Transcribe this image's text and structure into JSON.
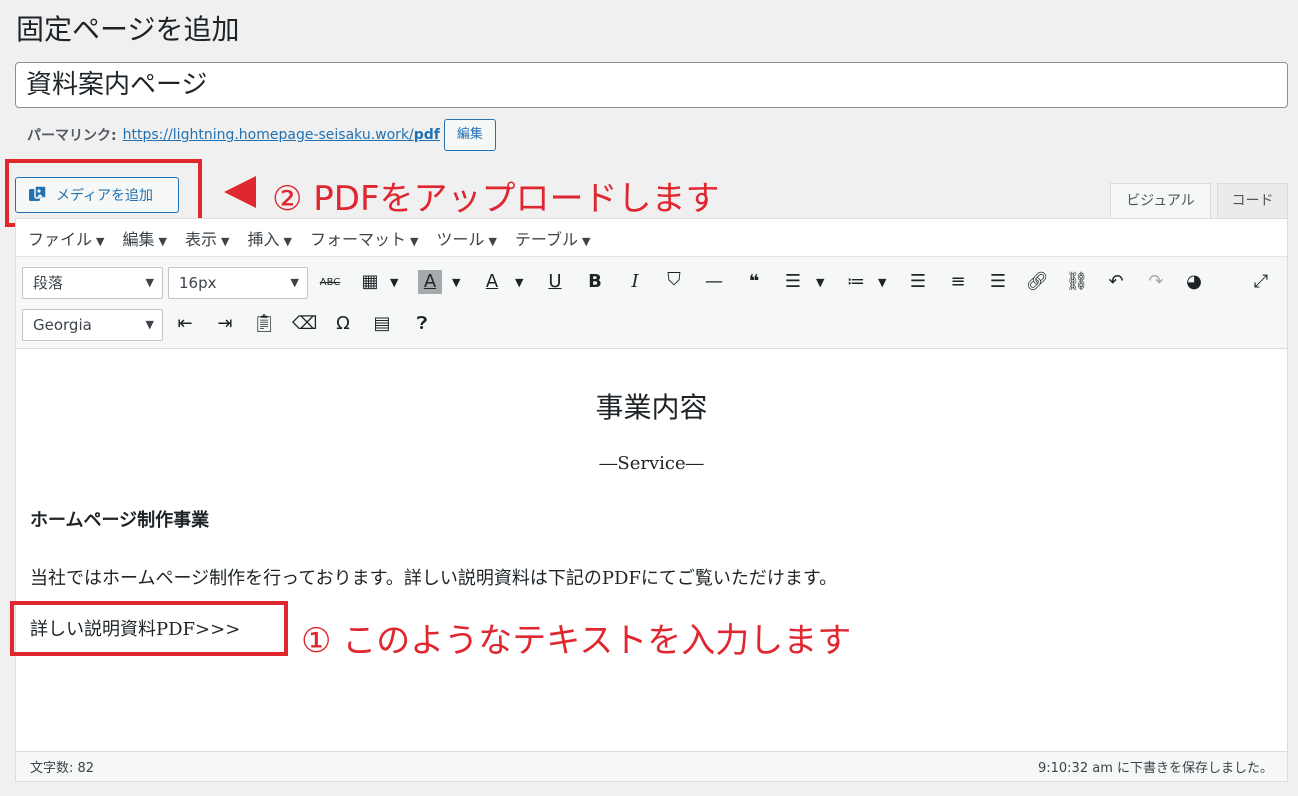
{
  "page": {
    "title": "固定ページを追加"
  },
  "post_title": {
    "value": "資料案内ページ"
  },
  "permalink": {
    "label": "パーマリンク:",
    "url_base": "https://lightning.homepage-seisaku.work/",
    "url_slug": "pdf",
    "edit_label": "編集"
  },
  "media": {
    "button_label": "メディアを追加",
    "icon": "media-icon"
  },
  "annotations": {
    "step2": "② PDFをアップロードします",
    "step1": "① このようなテキストを入力します",
    "color": "#e0262f"
  },
  "tabs": {
    "visual": "ビジュアル",
    "code": "コード"
  },
  "menubar": [
    "ファイル",
    "編集",
    "表示",
    "挿入",
    "フォーマット",
    "ツール",
    "テーブル"
  ],
  "toolbar": {
    "paragraph": "段落",
    "font_size": "16px",
    "font_family": "Georgia",
    "icons": [
      "strikethrough-icon",
      "table-icon",
      "background-color-icon",
      "text-color-icon",
      "underline-icon",
      "bold-icon",
      "italic-icon",
      "bookmark-icon",
      "horizontal-line-icon",
      "blockquote-icon",
      "bullet-list-icon",
      "numbered-list-icon",
      "align-left-icon",
      "align-center-icon",
      "align-right-icon",
      "link-icon",
      "unlink-icon",
      "undo-icon",
      "redo-icon",
      "pie-icon",
      "fullscreen-icon",
      "outdent-icon",
      "indent-icon",
      "paste-text-icon",
      "clear-format-icon",
      "special-char-icon",
      "more-tag-icon",
      "help-icon"
    ]
  },
  "content": {
    "heading": "事業内容",
    "subheading": "―Service―",
    "section_title": "ホームページ制作事業",
    "paragraph": "当社ではホームページ制作を行っております。詳しい説明資料は下記のPDFにてご覧いただけます。",
    "link_text": "詳しい説明資料PDF>>>"
  },
  "status": {
    "word_count": "文字数: 82",
    "saved": "9:10:32 am に下書きを保存しました。"
  }
}
